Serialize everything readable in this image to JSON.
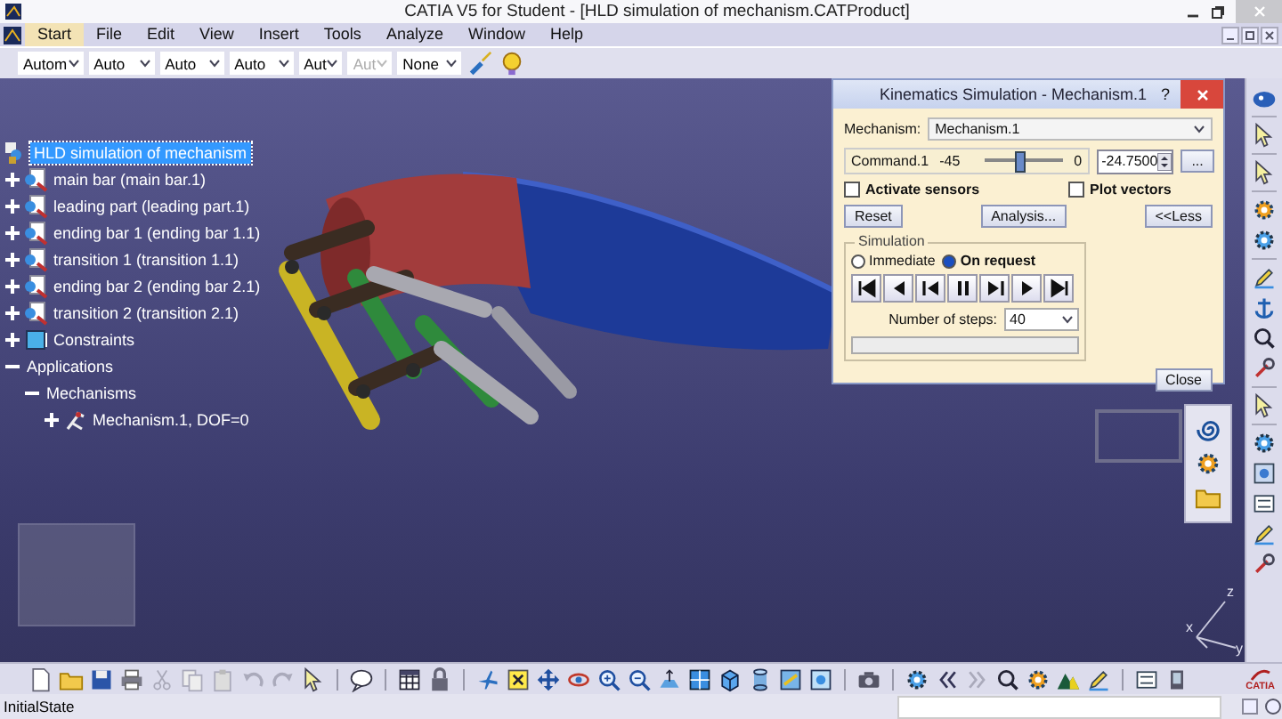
{
  "window": {
    "title": "CATIA V5 for Student - [HLD simulation of mechanism.CATProduct]"
  },
  "menu": [
    {
      "label": "Start",
      "selected": true
    },
    {
      "label": "File",
      "selected": false
    },
    {
      "label": "Edit",
      "selected": false
    },
    {
      "label": "View",
      "selected": false
    },
    {
      "label": "Insert",
      "selected": false
    },
    {
      "label": "Tools",
      "selected": false
    },
    {
      "label": "Analyze",
      "selected": false
    },
    {
      "label": "Window",
      "selected": false
    },
    {
      "label": "Help",
      "selected": false
    }
  ],
  "toolbar": {
    "dropdowns": [
      {
        "value": "Autom",
        "disabled": false
      },
      {
        "value": "Auto",
        "disabled": false
      },
      {
        "value": "Auto",
        "disabled": false
      },
      {
        "value": "Auto",
        "disabled": false
      },
      {
        "value": "Aut",
        "disabled": false
      },
      {
        "value": "Aut",
        "disabled": true
      },
      {
        "value": "None",
        "disabled": false
      }
    ]
  },
  "tree": {
    "root": {
      "label": "HLD simulation of mechanism",
      "kind": "product",
      "selected": true,
      "children": [
        {
          "label": "main bar (main bar.1)",
          "kind": "part",
          "expanded": false,
          "selected": false
        },
        {
          "label": "leading part (leading part.1)",
          "kind": "part",
          "expanded": false,
          "selected": false
        },
        {
          "label": "ending bar 1 (ending bar 1.1)",
          "kind": "part",
          "expanded": false,
          "selected": false
        },
        {
          "label": "transition 1 (transition 1.1)",
          "kind": "part",
          "expanded": false,
          "selected": false
        },
        {
          "label": "ending bar 2 (ending bar 2.1)",
          "kind": "part",
          "expanded": false,
          "selected": false
        },
        {
          "label": "transition 2 (transition 2.1)",
          "kind": "part",
          "expanded": false,
          "selected": false
        },
        {
          "label": "Constraints",
          "kind": "constraints",
          "expanded": false,
          "selected": false
        },
        {
          "label": "Applications",
          "expanded": true,
          "selected": false,
          "children": [
            {
              "label": "Mechanisms",
              "expanded": true,
              "selected": false,
              "children": [
                {
                  "label": "Mechanism.1, DOF=0",
                  "kind": "mechanism",
                  "expanded": false,
                  "selected": false
                }
              ]
            }
          ]
        }
      ]
    }
  },
  "dialog": {
    "title": "Kinematics Simulation - Mechanism.1",
    "help": "?",
    "mechanism_label": "Mechanism:",
    "mechanism_value": "Mechanism.1",
    "command": {
      "label": "Command.1",
      "min": "-45",
      "max": "0",
      "level": 0.45,
      "value": "-24.7500",
      "more": "..."
    },
    "checkboxes": [
      {
        "label": "Activate sensors",
        "checked": false
      },
      {
        "label": "Plot vectors",
        "checked": false
      }
    ],
    "reset": "Reset",
    "analysis": "Analysis...",
    "less": "<<Less",
    "simulation": {
      "title": "Simulation",
      "modes": [
        {
          "label": "Immediate",
          "selected": false
        },
        {
          "label": "On request",
          "selected": true
        }
      ],
      "steps_label": "Number of steps:",
      "steps": "40",
      "progress": {
        "level": 0
      }
    },
    "close": "Close"
  },
  "compass": {
    "axes": [
      "z",
      "x",
      "y"
    ]
  },
  "logo": {
    "text": "CATIA"
  },
  "status_bar": {
    "text": "InitialState"
  }
}
